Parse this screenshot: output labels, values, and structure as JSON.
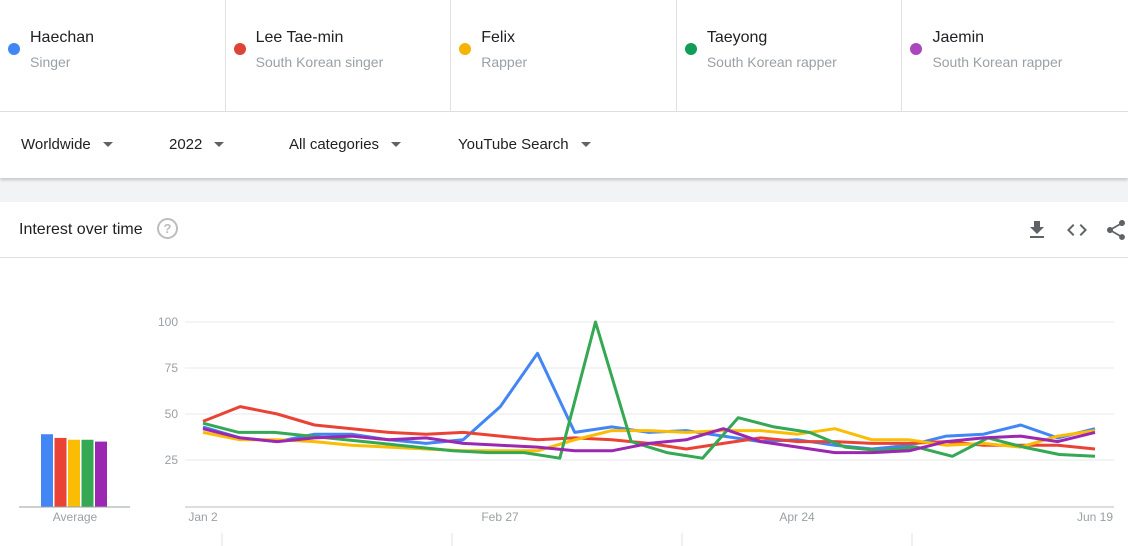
{
  "terms": [
    {
      "name": "Haechan",
      "sub": "Singer",
      "color": "#4285f4"
    },
    {
      "name": "Lee Tae-min",
      "sub": "South Korean singer",
      "color": "#db4437"
    },
    {
      "name": "Felix",
      "sub": "Rapper",
      "color": "#f4b400"
    },
    {
      "name": "Taeyong",
      "sub": "South Korean rapper",
      "color": "#0f9d58"
    },
    {
      "name": "Jaemin",
      "sub": "South Korean rapper",
      "color": "#ab47bc"
    }
  ],
  "filters": {
    "region": "Worldwide",
    "year": "2022",
    "category": "All categories",
    "source": "YouTube Search"
  },
  "card": {
    "title": "Interest over time",
    "help_icon": "?",
    "download_icon": "download-icon",
    "embed_icon": "embed-icon",
    "share_icon": "share-icon"
  },
  "chart_data": {
    "type": "line",
    "x_labels": [
      "Jan 2",
      "Feb 27",
      "Apr 24",
      "Jun 19"
    ],
    "y_ticks": [
      25,
      50,
      75,
      100
    ],
    "ylim": [
      0,
      100
    ],
    "average_label": "Average",
    "averages": [
      {
        "name": "Haechan",
        "value": 39,
        "color": "#4285f4"
      },
      {
        "name": "Lee Tae-min",
        "value": 37,
        "color": "#ea4335"
      },
      {
        "name": "Felix",
        "value": 36,
        "color": "#fbbc04"
      },
      {
        "name": "Taeyong",
        "value": 36,
        "color": "#34a853"
      },
      {
        "name": "Jaemin",
        "value": 35,
        "color": "#9c27b0"
      }
    ],
    "series": [
      {
        "name": "Haechan",
        "color": "#4285f4",
        "values": [
          43,
          37,
          35,
          39,
          39,
          36,
          34,
          36,
          54,
          83,
          40,
          43,
          40,
          41,
          38,
          35,
          36,
          33,
          31,
          33,
          38,
          39,
          44,
          37,
          42
        ]
      },
      {
        "name": "Lee Tae-min",
        "color": "#ea4335",
        "values": [
          46,
          54,
          50,
          44,
          42,
          40,
          39,
          40,
          38,
          36,
          37,
          36,
          34,
          31,
          34,
          37,
          35,
          35,
          34,
          34,
          35,
          33,
          33,
          33,
          31
        ]
      },
      {
        "name": "Felix",
        "color": "#fbbc04",
        "values": [
          40,
          36,
          36,
          35,
          33,
          32,
          31,
          30,
          30,
          30,
          36,
          41,
          41,
          40,
          41,
          41,
          39,
          42,
          36,
          36,
          33,
          34,
          32,
          38,
          41
        ]
      },
      {
        "name": "Taeyong",
        "color": "#34a853",
        "values": [
          45,
          40,
          40,
          38,
          36,
          34,
          32,
          30,
          29,
          29,
          26,
          100,
          35,
          29,
          26,
          48,
          43,
          40,
          32,
          30,
          32,
          27,
          37,
          32,
          28,
          27
        ]
      },
      {
        "name": "Jaemin",
        "color": "#9c27b0",
        "values": [
          42,
          37,
          35,
          37,
          38,
          36,
          37,
          34,
          33,
          32,
          30,
          30,
          34,
          36,
          42,
          35,
          32,
          29,
          29,
          30,
          35,
          37,
          38,
          35,
          40
        ]
      }
    ]
  }
}
